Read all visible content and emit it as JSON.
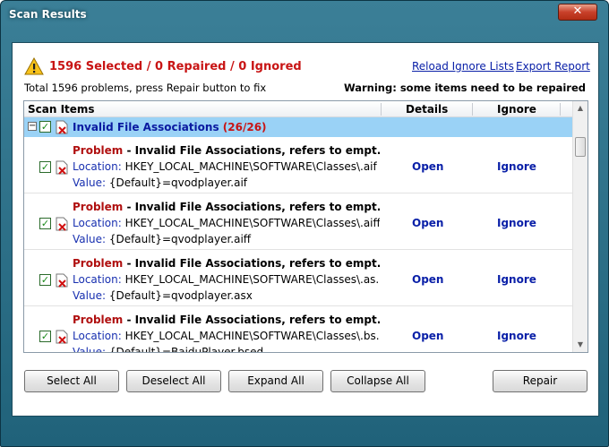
{
  "window": {
    "title": "Scan Results",
    "close_label": "✕"
  },
  "summary": {
    "status": "1596 Selected / 0 Repaired / 0 Ignored",
    "reload_link": "Reload Ignore Lists",
    "export_link": "Export Report",
    "subtext": "Total 1596 problems, press Repair button to fix",
    "warning": "Warning: some items need to be repaired"
  },
  "list": {
    "columns": [
      "Scan Items",
      "Details",
      "Ignore"
    ],
    "group": {
      "title": "Invalid File Associations",
      "count": "(26/26)"
    },
    "rows": [
      {
        "problem_label": "Problem",
        "problem_text": "Invalid File Associations, refers to empt...",
        "location_label": "Location:",
        "location": "HKEY_LOCAL_MACHINE\\SOFTWARE\\Classes\\.aif",
        "value_label": "Value:",
        "value": "{Default}=qvodplayer.aif",
        "details": "Open",
        "ignore": "Ignore"
      },
      {
        "problem_label": "Problem",
        "problem_text": "Invalid File Associations, refers to empt...",
        "location_label": "Location:",
        "location": "HKEY_LOCAL_MACHINE\\SOFTWARE\\Classes\\.aiff",
        "value_label": "Value:",
        "value": "{Default}=qvodplayer.aiff",
        "details": "Open",
        "ignore": "Ignore"
      },
      {
        "problem_label": "Problem",
        "problem_text": "Invalid File Associations, refers to empt...",
        "location_label": "Location:",
        "location": "HKEY_LOCAL_MACHINE\\SOFTWARE\\Classes\\.as...",
        "value_label": "Value:",
        "value": "{Default}=qvodplayer.asx",
        "details": "Open",
        "ignore": "Ignore"
      },
      {
        "problem_label": "Problem",
        "problem_text": "Invalid File Associations, refers to empt...",
        "location_label": "Location:",
        "location": "HKEY_LOCAL_MACHINE\\SOFTWARE\\Classes\\.bs...",
        "value_label": "Value:",
        "value": "{Default}=BaiduPlayer.bsed",
        "details": "Open",
        "ignore": "Ignore"
      }
    ]
  },
  "buttons": {
    "select_all": "Select All",
    "deselect_all": "Deselect All",
    "expand_all": "Expand All",
    "collapse_all": "Collapse All",
    "repair": "Repair"
  },
  "icons": {
    "warning": "warning-icon",
    "close": "close-icon",
    "checkbox": "checkbox-icon",
    "document_error": "document-error-icon",
    "expander": "collapse-icon"
  },
  "colors": {
    "title_bar": "#2c6f88",
    "selected_row": "#9ad2f6",
    "status_red": "#c81414",
    "link_blue": "#0a20a8"
  }
}
